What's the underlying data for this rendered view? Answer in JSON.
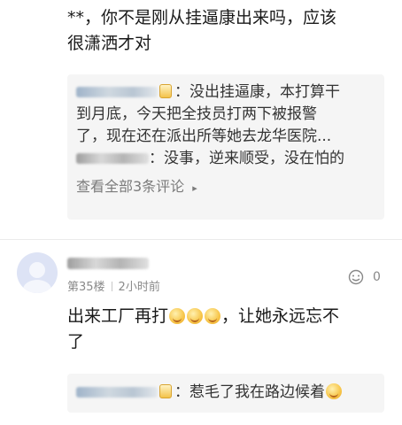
{
  "comment_top": {
    "text_line1": "**，你不是刚从挂逼康出来吗，应该",
    "text_line2": "很潇洒才对"
  },
  "reply_box_1": {
    "reply1_name": "J醉卧红尘",
    "reply1_line1": "：没出挂逼康，本打算干",
    "reply1_line2": "到月底，今天把全技员打两下被报警",
    "reply1_line3": "了，现在还在派出所等她去龙华医院...",
    "reply2_text": "：没事，逆来顺受，没在怕的",
    "more_link": "查看全部3条评论"
  },
  "comment_35": {
    "floor": "第35楼",
    "time": "2小时前",
    "like_count": "0",
    "text_line1_pre": "出来工厂再打",
    "text_line1_post": "，让她永远忘不",
    "text_line2": "了"
  },
  "reply_box_2": {
    "reply_text": "：惹毛了我在路边候着"
  },
  "icons": [
    "badge-icon",
    "grin-emoji-icon",
    "like-icon",
    "chevron-right-icon",
    "avatar-placeholder-icon"
  ]
}
